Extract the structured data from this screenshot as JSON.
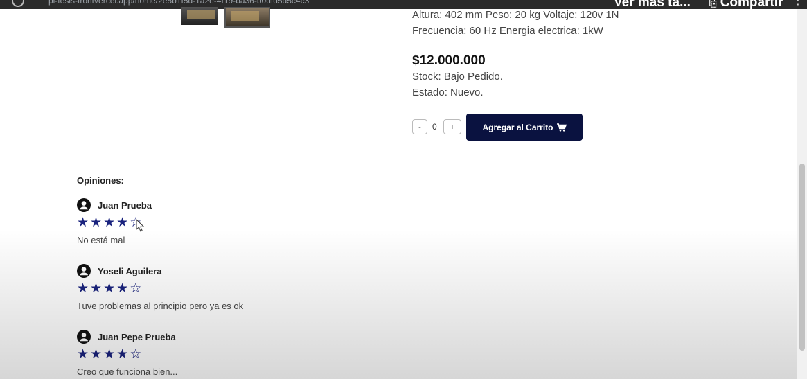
{
  "browser": {
    "url": "pi-tesis-frontvercel.app/home/2e5b1f5d-1a2e-4f19-ba36-b0dfd5d5c4c3",
    "overlay_buttons": [
      "Ver más ta...",
      "Compartir"
    ]
  },
  "product": {
    "spec_line1": "Altura: 402 mm Peso: 20 kg Voltaje: 120v 1N",
    "spec_line2": "Frecuencia: 60 Hz Energia electrica: 1kW",
    "price": "$12.000.000",
    "stock": "Stock: Bajo Pedido.",
    "estado": "Estado: Nuevo.",
    "qty_minus": "-",
    "qty_value": "0",
    "qty_plus": "+",
    "add_to_cart": "Agregar al Carrito"
  },
  "reviews_heading": "Opiniones:",
  "reviews": [
    {
      "name": "Juan Prueba",
      "rating": 4,
      "max": 5,
      "comment": "No está mal"
    },
    {
      "name": "Yoseli Aguilera",
      "rating": 4,
      "max": 5,
      "comment": "Tuve problemas al principio pero ya es ok"
    },
    {
      "name": "Juan Pepe Prueba",
      "rating": 4,
      "max": 5,
      "comment": "Creo que funciona bien..."
    }
  ],
  "colors": {
    "accent": "#0a1240",
    "star": "#1a237e"
  }
}
